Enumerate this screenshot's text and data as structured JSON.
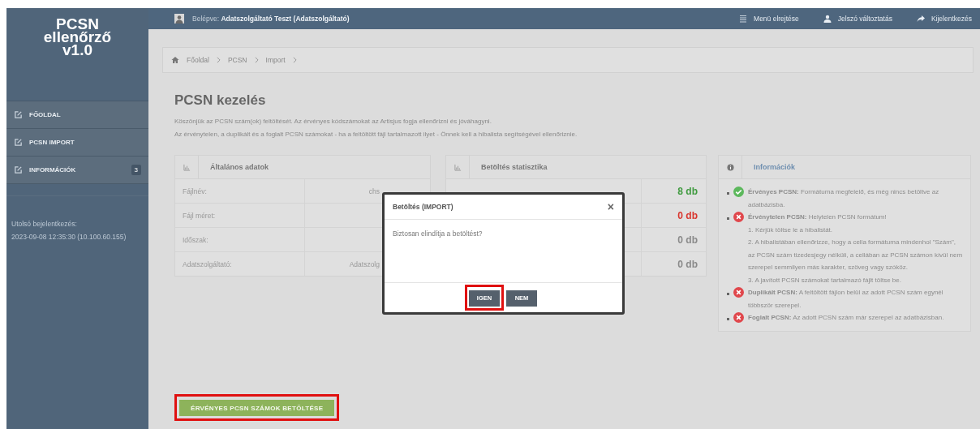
{
  "sidebar": {
    "logo_lines": [
      "PCSN",
      "ellenőrző",
      "v1.0"
    ],
    "items": [
      {
        "label": "FŐOLDAL"
      },
      {
        "label": "PCSN IMPORT"
      },
      {
        "label": "INFORMÁCIÓK",
        "badge": "3"
      }
    ],
    "last_login_label": "Utolsó bejelentkezés:",
    "last_login_value": "2023-09-08 12:35:30 (10.100.60.155)"
  },
  "top_bar": {
    "user_label": "Belépve:",
    "user_name": "Adatszolgáltató Teszt (Adatszolgáltató)",
    "actions": [
      {
        "kind": "menu",
        "label": "Menü elrejtése"
      },
      {
        "kind": "user",
        "label": "Jelszó változtatás"
      },
      {
        "kind": "logout",
        "label": "Kijelentkezés"
      }
    ]
  },
  "breadcrumb": [
    "Főoldal",
    "PCSN",
    "Import"
  ],
  "title": "PCSN kezelés",
  "paragraphs": [
    "Köszönjük az PCSN szám(ok) feltöltését. Az érvényes kódszámokat az Artisjus fogja ellenőrizni és jóváhagyni.",
    "Az érvénytelen, a duplikált és a foglalt PCSN számokat - ha a feltöltött fájl tartalmazott ilyet - Önnek kell a hibalista segítségével ellenőriznie."
  ],
  "general_panel": {
    "title": "Általános adatok",
    "rows": [
      {
        "label": "Fájlnév:",
        "value": "chs"
      },
      {
        "label": "Fájl méret:",
        "value": ""
      },
      {
        "label": "Időszak:",
        "value": ""
      },
      {
        "label": "Adatszolgáltató:",
        "value": "Adatszolg"
      }
    ]
  },
  "stats_panel": {
    "title": "Betöltés statisztika",
    "rows": [
      {
        "value": "8 db",
        "color": "#3f9a3f"
      },
      {
        "value": "0 db",
        "color": "#d9362e"
      },
      {
        "value": "0 db",
        "color": "#8a8a8a"
      },
      {
        "value": "0 db",
        "color": "#8a8a8a"
      }
    ]
  },
  "info_panel": {
    "title": "Információk",
    "items": [
      {
        "kind": "valid",
        "text": "**Érvényes PCSN:** Formátuma megfelelő, és még nincs betöltve az adatbázisba."
      },
      {
        "kind": "invalid",
        "text": "**Érvénytelen PCSN:** Helytelen PCSN formátum!",
        "steps": [
          "1. Kérjük töltse le a hibalistát.",
          "2. A hibalistában ellenőrizze, hogy a cella formátuma mindenhol \"Szám\", az PCSN szám tizedesjegy nélküli, a cellában az PCSN számon kívül nem szerepel semmilyen más karakter, szöveg vagy szóköz.",
          "3. A javított PCSN számokat tartalmazó fájlt töltse be."
        ]
      },
      {
        "kind": "invalid",
        "text": "**Duplikált PCSN:** A feltöltött fájlon belül az adott PCSN szám egynél többször szerepel."
      },
      {
        "kind": "invalid",
        "text": "**Foglalt PCSN:** Az adott PCSN szám már szerepel az adatbázisban."
      }
    ]
  },
  "load_button": {
    "label": "ÉRVÉNYES PCSN SZÁMOK BETÖLTÉSE",
    "highlighted": true
  },
  "dialog": {
    "title": "Betöltés (IMPORT)",
    "close": "×",
    "message": "Biztosan elindítja a betöltést?",
    "buttons": [
      {
        "label": "IGEN",
        "highlighted": true
      },
      {
        "label": "NEM",
        "highlighted": false
      }
    ]
  }
}
